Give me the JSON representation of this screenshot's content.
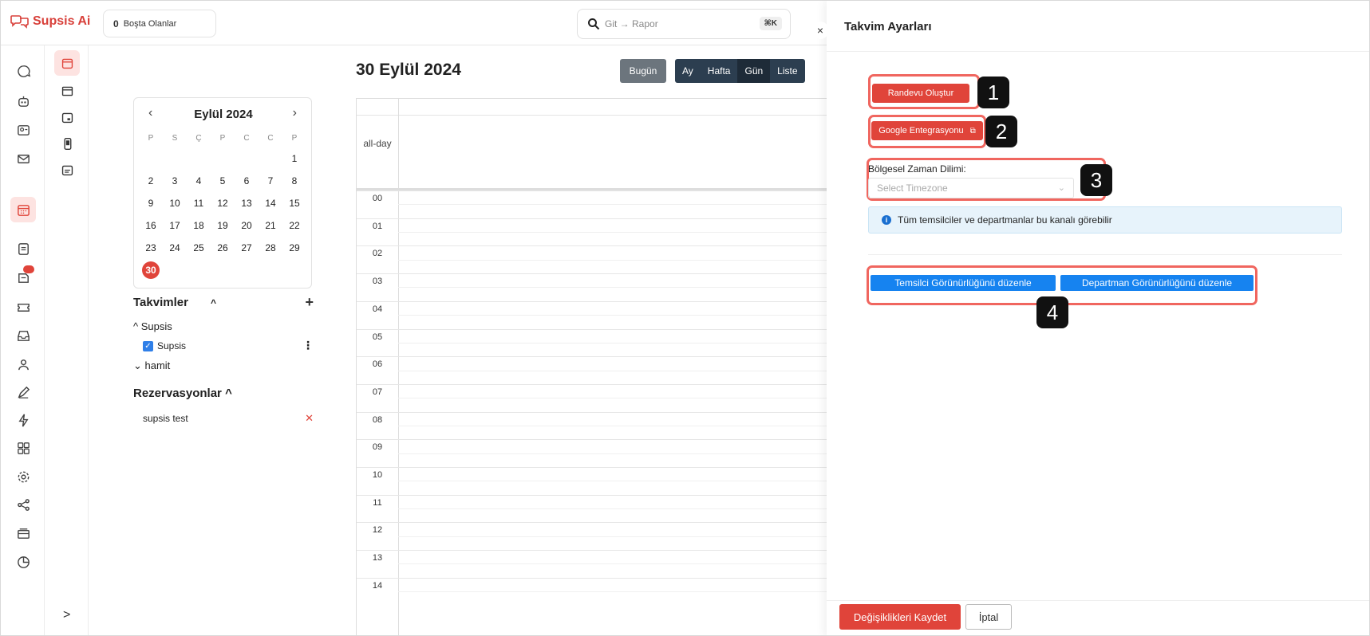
{
  "app": {
    "name": "Supsis Ai",
    "accent": "#e0443a"
  },
  "topbar": {
    "idle_count": "0",
    "idle_label": "Boşta Olanlar",
    "search_placeholder": "Git → Rapor",
    "search_shortcut": "⌘K"
  },
  "calendar": {
    "title": "30 Eylül 2024",
    "today_btn": "Bugün",
    "views": [
      "Ay",
      "Hafta",
      "Gün",
      "Liste"
    ],
    "active_view": "Gün",
    "allday_label": "all-day",
    "hours": [
      "00",
      "01",
      "02",
      "03",
      "04",
      "05",
      "06",
      "07",
      "08",
      "09",
      "10",
      "11",
      "12",
      "13",
      "14"
    ]
  },
  "minical": {
    "month": "Eylül 2024",
    "prev": "‹",
    "next": "›",
    "dow": [
      "P",
      "S",
      "Ç",
      "P",
      "C",
      "C",
      "P"
    ],
    "weeks": [
      [
        "",
        "",
        "",
        "",
        "",
        "",
        "1"
      ],
      [
        "2",
        "3",
        "4",
        "5",
        "6",
        "7",
        "8"
      ],
      [
        "9",
        "10",
        "11",
        "12",
        "13",
        "14",
        "15"
      ],
      [
        "16",
        "17",
        "18",
        "19",
        "20",
        "21",
        "22"
      ],
      [
        "23",
        "24",
        "25",
        "26",
        "27",
        "28",
        "29"
      ],
      [
        "30",
        "",
        "",
        "",
        "",
        "",
        ""
      ]
    ],
    "today": "30"
  },
  "calendars": {
    "title": "Takvimler",
    "groups": [
      {
        "label": "^ Supsis"
      },
      {
        "label": "⌄ hamit"
      }
    ],
    "items": [
      {
        "label": "Supsis",
        "checked": true
      }
    ]
  },
  "reservations": {
    "title": "Rezervasyonlar ^",
    "items": [
      {
        "label": "supsis test"
      }
    ]
  },
  "panel": {
    "title": "Takvim Ayarları",
    "create_btn": "Randevu Oluştur",
    "google_btn": "Google Entegrasyonu",
    "tz_label": "Bölgesel Zaman Dilimi:",
    "tz_placeholder": "Select Timezone",
    "info_text": "Tüm temsilciler ve departmanlar bu kanalı görebilir",
    "agent_btn": "Temsilci Görünürlüğünü düzenle",
    "dept_btn": "Departman Görünürlüğünü düzenle",
    "save_btn": "Değişiklikleri Kaydet",
    "cancel_btn": "İptal",
    "markers": [
      "1",
      "2",
      "3",
      "4"
    ],
    "close": "×"
  },
  "nav": {
    "expand": ">"
  }
}
